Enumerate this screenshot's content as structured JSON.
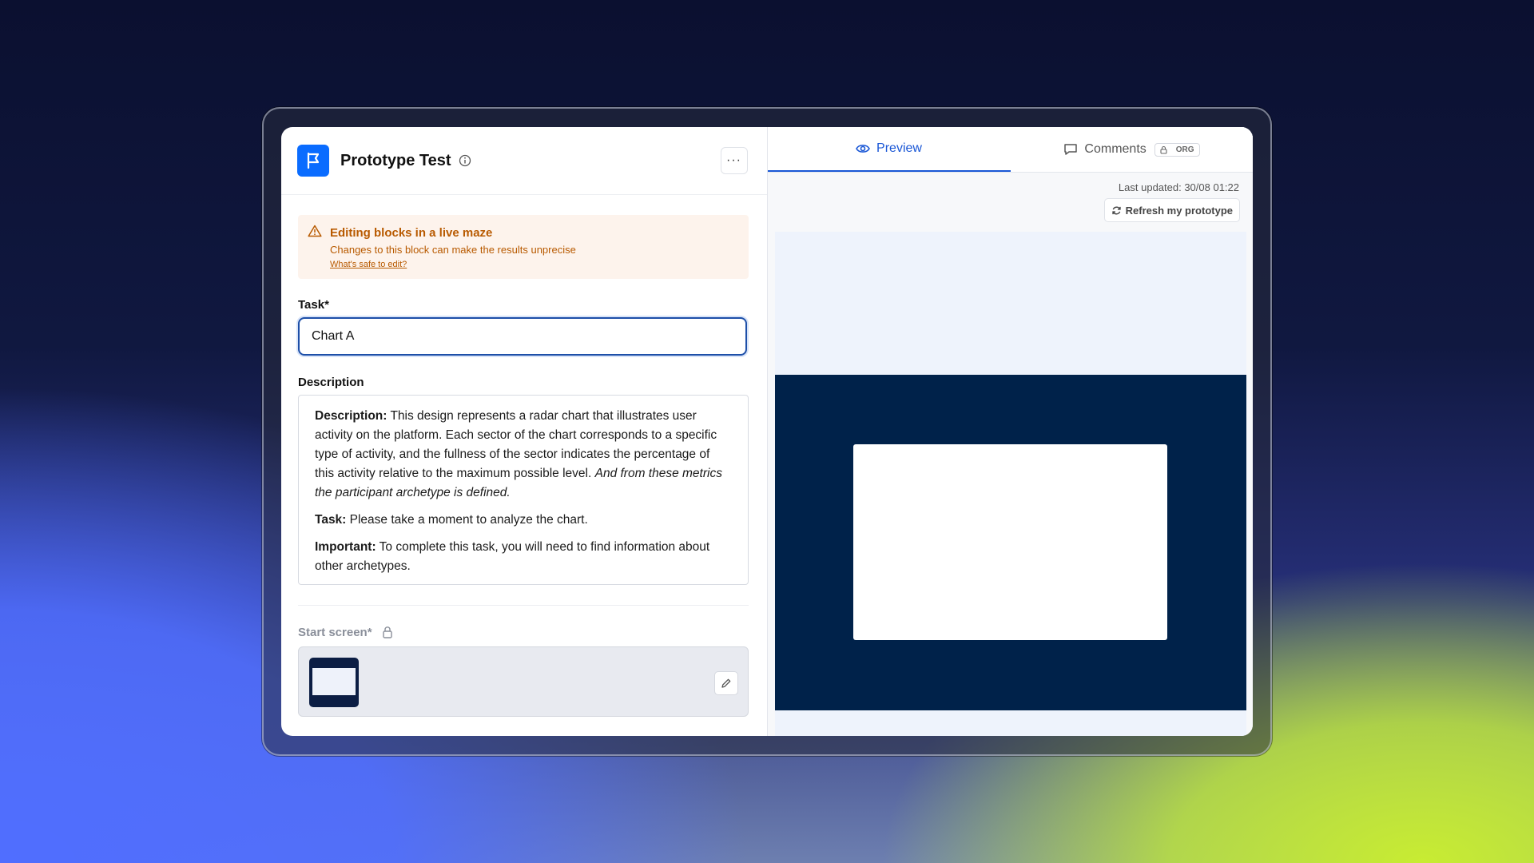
{
  "header": {
    "title": "Prototype Test",
    "more_label": "···"
  },
  "warning": {
    "title": "Editing blocks in a live maze",
    "text": "Changes to this block can make the results unprecise",
    "link": "What's safe to edit?"
  },
  "task": {
    "label": "Task*",
    "value": "Chart A"
  },
  "description": {
    "label": "Description",
    "p1_bold": "Description:",
    "p1_text": " This design represents a radar chart that illustrates user activity on the platform. Each sector of the chart corresponds to a specific type of activity, and the fullness of the sector indicates the percentage of this activity relative to the maximum possible level. ",
    "p1_italic": "And from these metrics the participant archetype is defined.",
    "p2_bold": "Task:",
    "p2_text": " Please take a moment to analyze the chart.",
    "p3_bold": "Important:",
    "p3_text": " To complete this task, you will need to find information about other archetypes."
  },
  "start_screen": {
    "label": "Start screen*"
  },
  "tabs": {
    "preview": "Preview",
    "comments": "Comments",
    "org_badge": "ORG"
  },
  "preview": {
    "last_updated": "Last updated: 30/08 01:22",
    "refresh_label": "Refresh my prototype"
  },
  "colors": {
    "brand": "#0a6cff",
    "active_tab": "#1a57d6",
    "warning": "#b85a00",
    "preview_dark": "#00224a"
  }
}
